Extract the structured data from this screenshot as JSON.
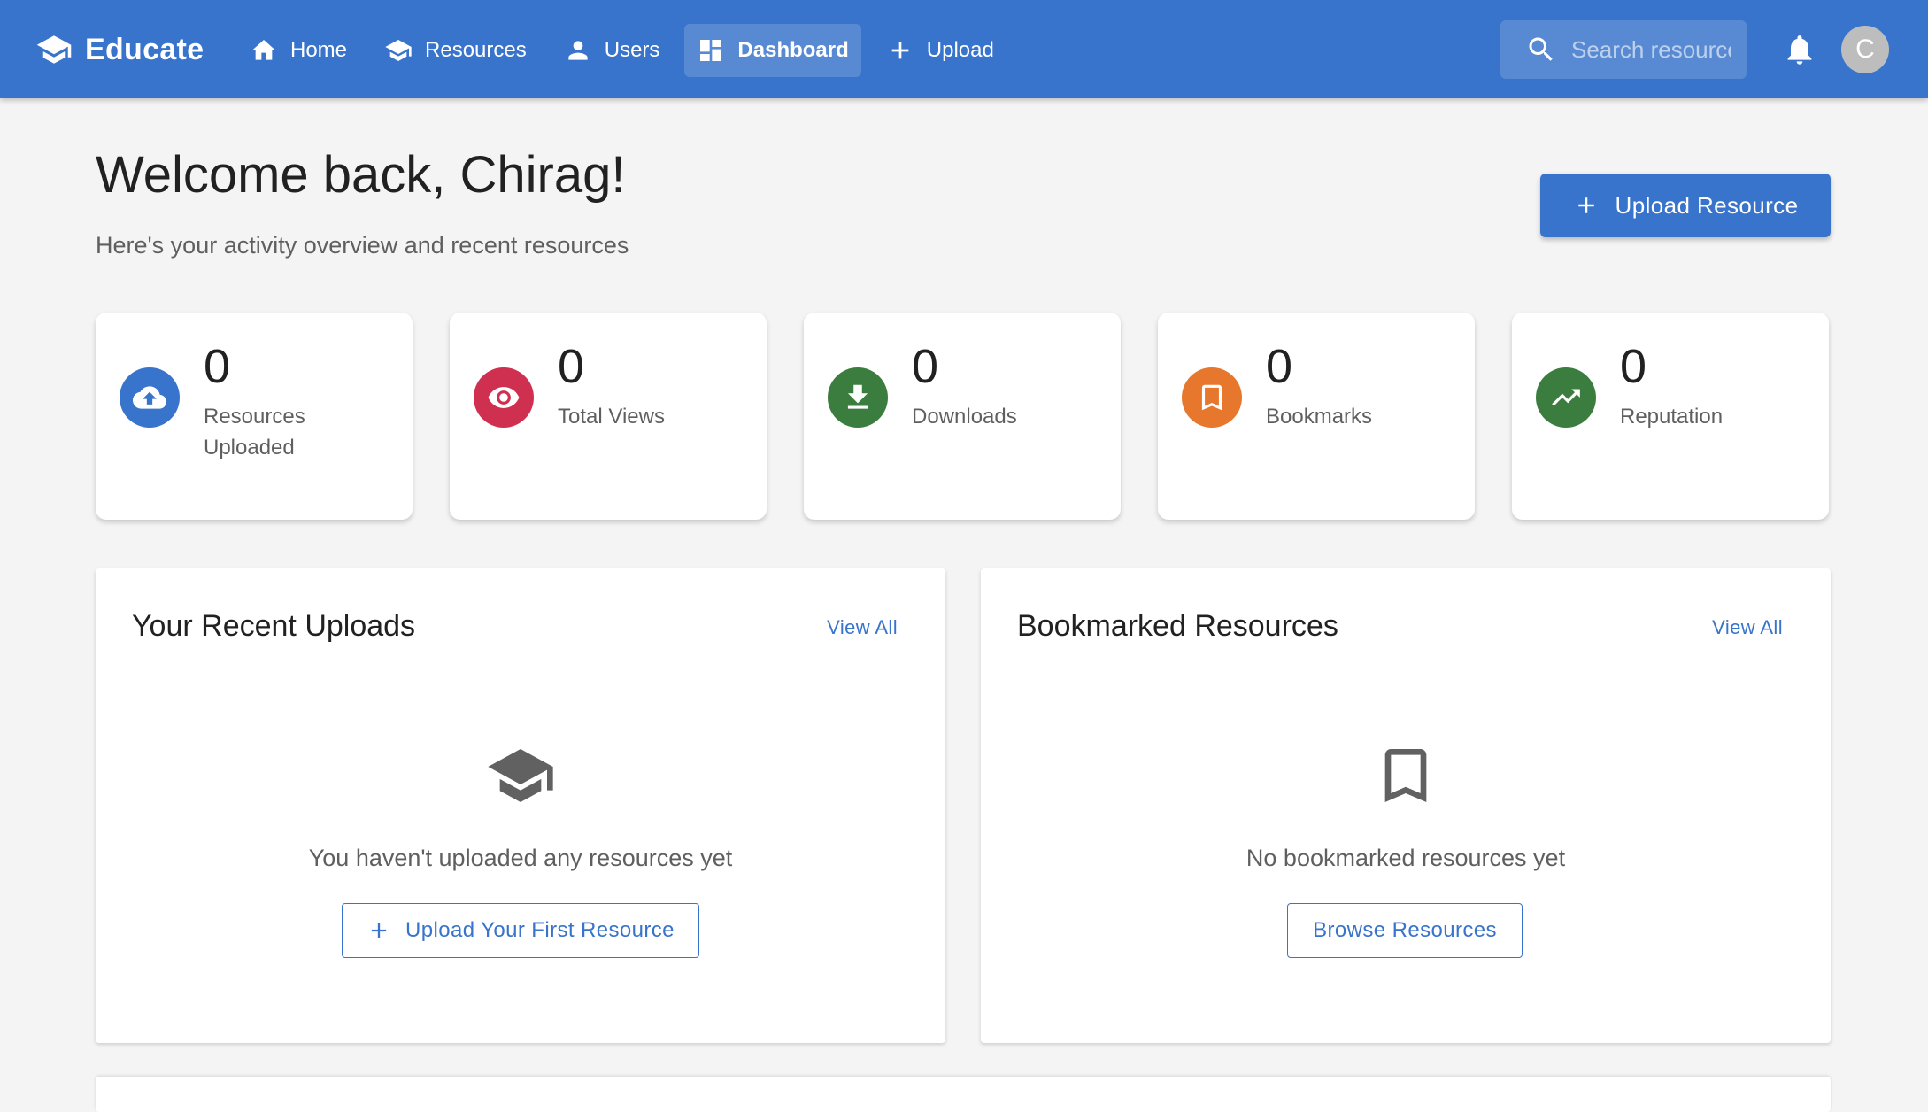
{
  "app": {
    "name": "Educate"
  },
  "nav": {
    "items": [
      {
        "label": "Home",
        "icon": "home-icon"
      },
      {
        "label": "Resources",
        "icon": "school-icon"
      },
      {
        "label": "Users",
        "icon": "person-icon"
      },
      {
        "label": "Dashboard",
        "icon": "dashboard-icon",
        "active": true
      },
      {
        "label": "Upload",
        "icon": "plus-icon"
      }
    ]
  },
  "search": {
    "placeholder": "Search resources..."
  },
  "user": {
    "avatar_initial": "C"
  },
  "header": {
    "title": "Welcome back, Chirag!",
    "subtitle": "Here's your activity overview and recent resources",
    "upload_button": "Upload Resource"
  },
  "stats": [
    {
      "value": "0",
      "label": "Resources Uploaded",
      "icon": "cloud-upload-icon",
      "color": "#3874cb"
    },
    {
      "value": "0",
      "label": "Total Views",
      "icon": "eye-icon",
      "color": "#d0304f"
    },
    {
      "value": "0",
      "label": "Downloads",
      "icon": "download-icon",
      "color": "#3b7d3e"
    },
    {
      "value": "0",
      "label": "Bookmarks",
      "icon": "bookmark-icon",
      "color": "#e7772d"
    },
    {
      "value": "0",
      "label": "Reputation",
      "icon": "trending-up-icon",
      "color": "#3b7d3e"
    }
  ],
  "recent_uploads": {
    "title": "Your Recent Uploads",
    "view_all": "View All",
    "empty_text": "You haven't uploaded any resources yet",
    "button": "Upload Your First Resource"
  },
  "bookmarks": {
    "title": "Bookmarked Resources",
    "view_all": "View All",
    "empty_text": "No bookmarked resources yet",
    "button": "Browse Resources"
  },
  "colors": {
    "primary": "#3874cb",
    "background": "#f4f4f4"
  }
}
